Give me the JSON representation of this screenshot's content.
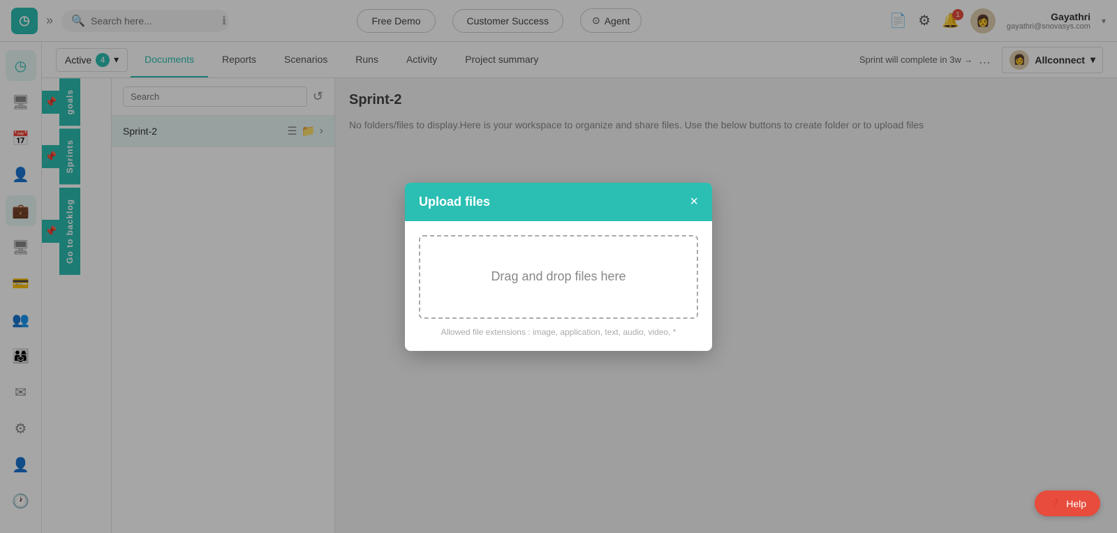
{
  "topNav": {
    "logo": "◷",
    "expand": "»",
    "search": {
      "placeholder": "Search here...",
      "infoIcon": "ℹ"
    },
    "navButtons": [
      {
        "label": "Free Demo",
        "type": "outline"
      },
      {
        "label": "Customer Success",
        "type": "outline"
      }
    ],
    "agentBtn": {
      "icon": "⊙",
      "label": "Agent"
    },
    "icons": [
      "📄",
      "⚙",
      "🔔"
    ],
    "notificationCount": "1",
    "user": {
      "name": "Gayathri",
      "email": "gayathri@snovasys.com"
    },
    "dropdownArrow": "▾"
  },
  "secondaryNav": {
    "activeLabel": "Active",
    "activeCount": "4",
    "tabs": [
      {
        "label": "Documents",
        "active": true
      },
      {
        "label": "Reports"
      },
      {
        "label": "Scenarios"
      },
      {
        "label": "Runs"
      },
      {
        "label": "Activity"
      },
      {
        "label": "Project summary"
      }
    ],
    "sprintComplete": "Sprint will complete in 3w →",
    "moreDots": "…",
    "allconnect": {
      "label": "Allconnect",
      "arrow": "▾"
    }
  },
  "sidebar": {
    "icons": [
      {
        "name": "clock-icon",
        "symbol": "◷",
        "active": true
      },
      {
        "name": "monitor-icon",
        "symbol": "🖥"
      },
      {
        "name": "calendar-icon",
        "symbol": "📅"
      },
      {
        "name": "person-icon",
        "symbol": "👤"
      },
      {
        "name": "briefcase-icon",
        "symbol": "💼",
        "active": true
      },
      {
        "name": "desktop-icon",
        "symbol": "🖥"
      },
      {
        "name": "card-icon",
        "symbol": "💳"
      },
      {
        "name": "users-icon",
        "symbol": "👥"
      },
      {
        "name": "team-icon",
        "symbol": "👨‍👩‍👧"
      },
      {
        "name": "mail-icon",
        "symbol": "✉"
      },
      {
        "name": "settings-icon",
        "symbol": "⚙"
      },
      {
        "name": "user-settings-icon",
        "symbol": "👤"
      },
      {
        "name": "history-icon",
        "symbol": "🕐"
      }
    ]
  },
  "sprintSideTabs": {
    "goalsLabel": "goals",
    "sprintsLabel": "Sprints",
    "backlogLabel": "Go to backlog"
  },
  "sprintPanel": {
    "searchPlaceholder": "Search",
    "resetIcon": "↺",
    "items": [
      {
        "name": "Sprint-2"
      }
    ]
  },
  "mainContent": {
    "sprintTitle": "Sprint-2",
    "noFilesMsg": "No folders/files to display.Here is your workspace to organize and share files. Use the below buttons to create folder or to upload files"
  },
  "modal": {
    "title": "Upload files",
    "closeLabel": "×",
    "dropZoneText": "Drag and drop files here",
    "fileExtensions": "Allowed file extensions : image, application, text, audio, video, *"
  },
  "helpBtn": {
    "icon": "?",
    "label": "Help"
  }
}
